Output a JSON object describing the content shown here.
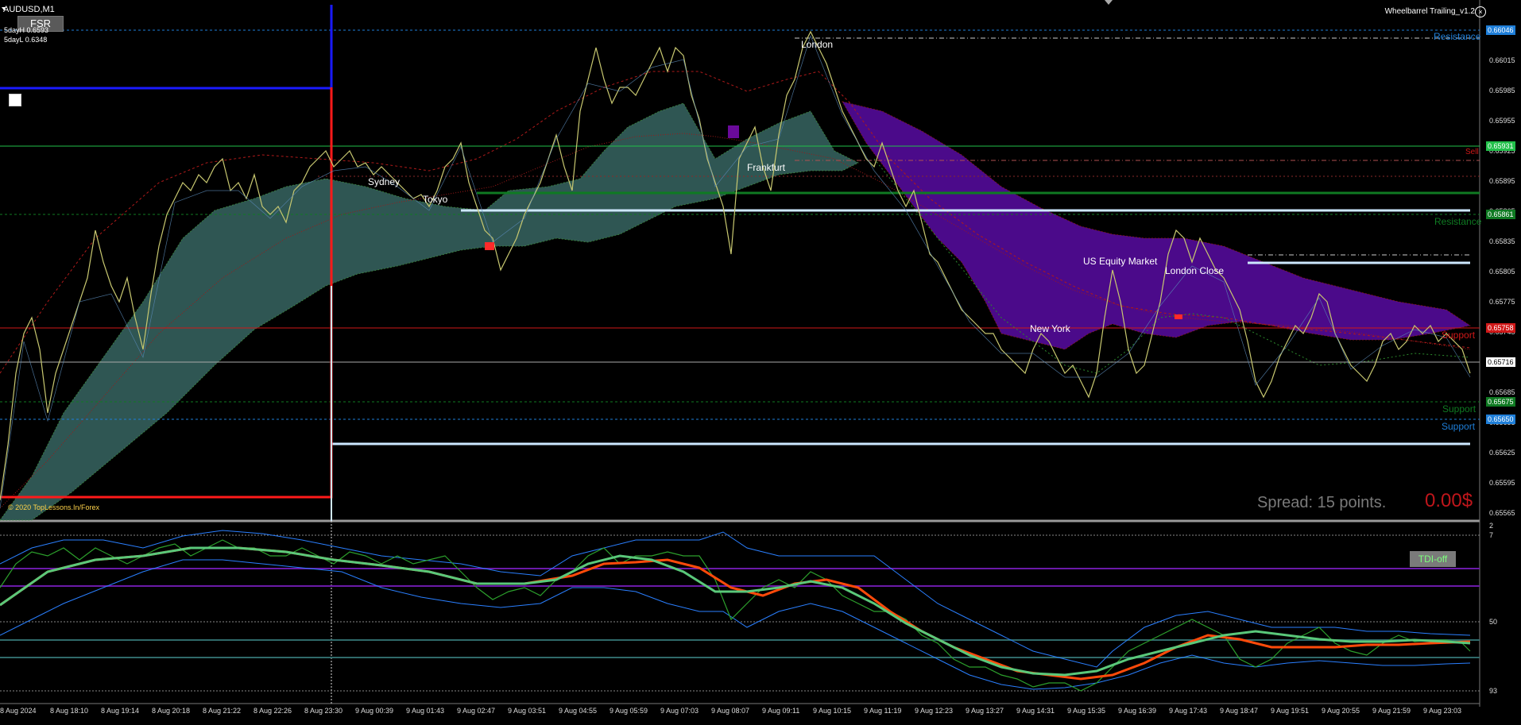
{
  "header": {
    "symbol_label": "AUDUSD,M1",
    "fsr_button": "FSR",
    "five_day_high": "5dayH 0.6593",
    "five_day_low": "5dayL 0.6348",
    "indicator_name": "Wheelbarrel Trailing_v1.2",
    "copyright": "© 2020 TopLessons.In/Forex"
  },
  "sessions": [
    {
      "label": "Sydney"
    },
    {
      "label": "Tokyo"
    },
    {
      "label": "London"
    },
    {
      "label": "Frankfurt"
    },
    {
      "label": "New York"
    },
    {
      "label": "US Equity Market"
    },
    {
      "label": "London Close"
    }
  ],
  "levels": {
    "resistance_top": "Resistance",
    "resistance_mid": "Resistance",
    "sell": "Sell",
    "support_red": "Support",
    "support_green": "Support",
    "support_blue": "Support"
  },
  "price_tags": [
    {
      "value": "0.66046",
      "color": "#1e7ed8"
    },
    {
      "value": "0.65931",
      "color": "#22c04a"
    },
    {
      "value": "0.65861",
      "color": "#0f7a22"
    },
    {
      "value": "0.65758",
      "color": "#d01818"
    },
    {
      "value": "0.65716",
      "color": "#ffffff"
    },
    {
      "value": "0.65675",
      "color": "#0f7a22"
    },
    {
      "value": "0.65650",
      "color": "#1e7ed8"
    }
  ],
  "price_axis": [
    "0.66015",
    "0.65985",
    "0.65955",
    "0.65925",
    "0.65895",
    "0.65865",
    "0.65835",
    "0.65805",
    "0.65775",
    "0.65745",
    "0.65685",
    "0.65655",
    "0.65625",
    "0.65595",
    "0.65565"
  ],
  "time_axis": [
    "8 Aug 2024",
    "8 Aug 18:10",
    "8 Aug 19:14",
    "8 Aug 20:18",
    "8 Aug 21:22",
    "8 Aug 22:26",
    "8 Aug 23:30",
    "9 Aug 00:39",
    "9 Aug 01:43",
    "9 Aug 02:47",
    "9 Aug 03:51",
    "9 Aug 04:55",
    "9 Aug 05:59",
    "9 Aug 07:03",
    "9 Aug 08:07",
    "9 Aug 09:11",
    "9 Aug 10:15",
    "9 Aug 11:19",
    "9 Aug 12:23",
    "9 Aug 13:27",
    "9 Aug 14:31",
    "9 Aug 15:35",
    "9 Aug 16:39",
    "9 Aug 17:43",
    "9 Aug 18:47",
    "9 Aug 19:51",
    "9 Aug 20:55",
    "9 Aug 21:59",
    "9 Aug 23:03"
  ],
  "footer": {
    "spread_text": "Spread: 15 points.",
    "spread_value": "0.00$"
  },
  "sub_window": {
    "tdi_button": "TDI-off",
    "axis_labels": [
      "2",
      "7",
      "50",
      "93"
    ]
  },
  "colors": {
    "background": "#000000",
    "cloud_green": "#2f5653",
    "cloud_purple": "#4b0a8a",
    "price_line": "#c8c870",
    "rsi_green": "#2ca02c",
    "signal_red": "#ff4a0a",
    "band_blue": "#2a7fff"
  }
}
